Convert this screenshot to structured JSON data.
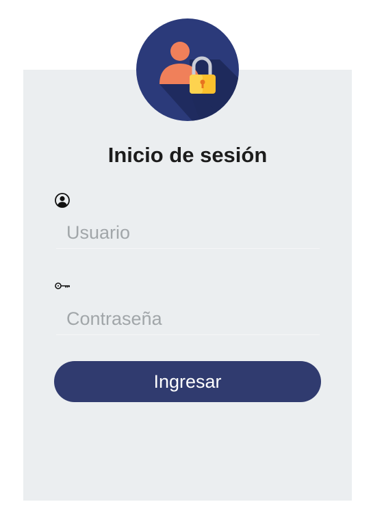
{
  "login": {
    "title": "Inicio de sesión",
    "username_placeholder": "Usuario",
    "password_placeholder": "Contraseña",
    "submit_label": "Ingresar"
  },
  "icons": {
    "logo": "user-lock-icon",
    "username": "user-circle-icon",
    "password": "key-icon"
  },
  "colors": {
    "card_background": "#ebeef0",
    "button": "#303b6f",
    "logo_circle": "#2b3a7a",
    "logo_user": "#f0805a",
    "logo_lock": "#fbc02d"
  }
}
